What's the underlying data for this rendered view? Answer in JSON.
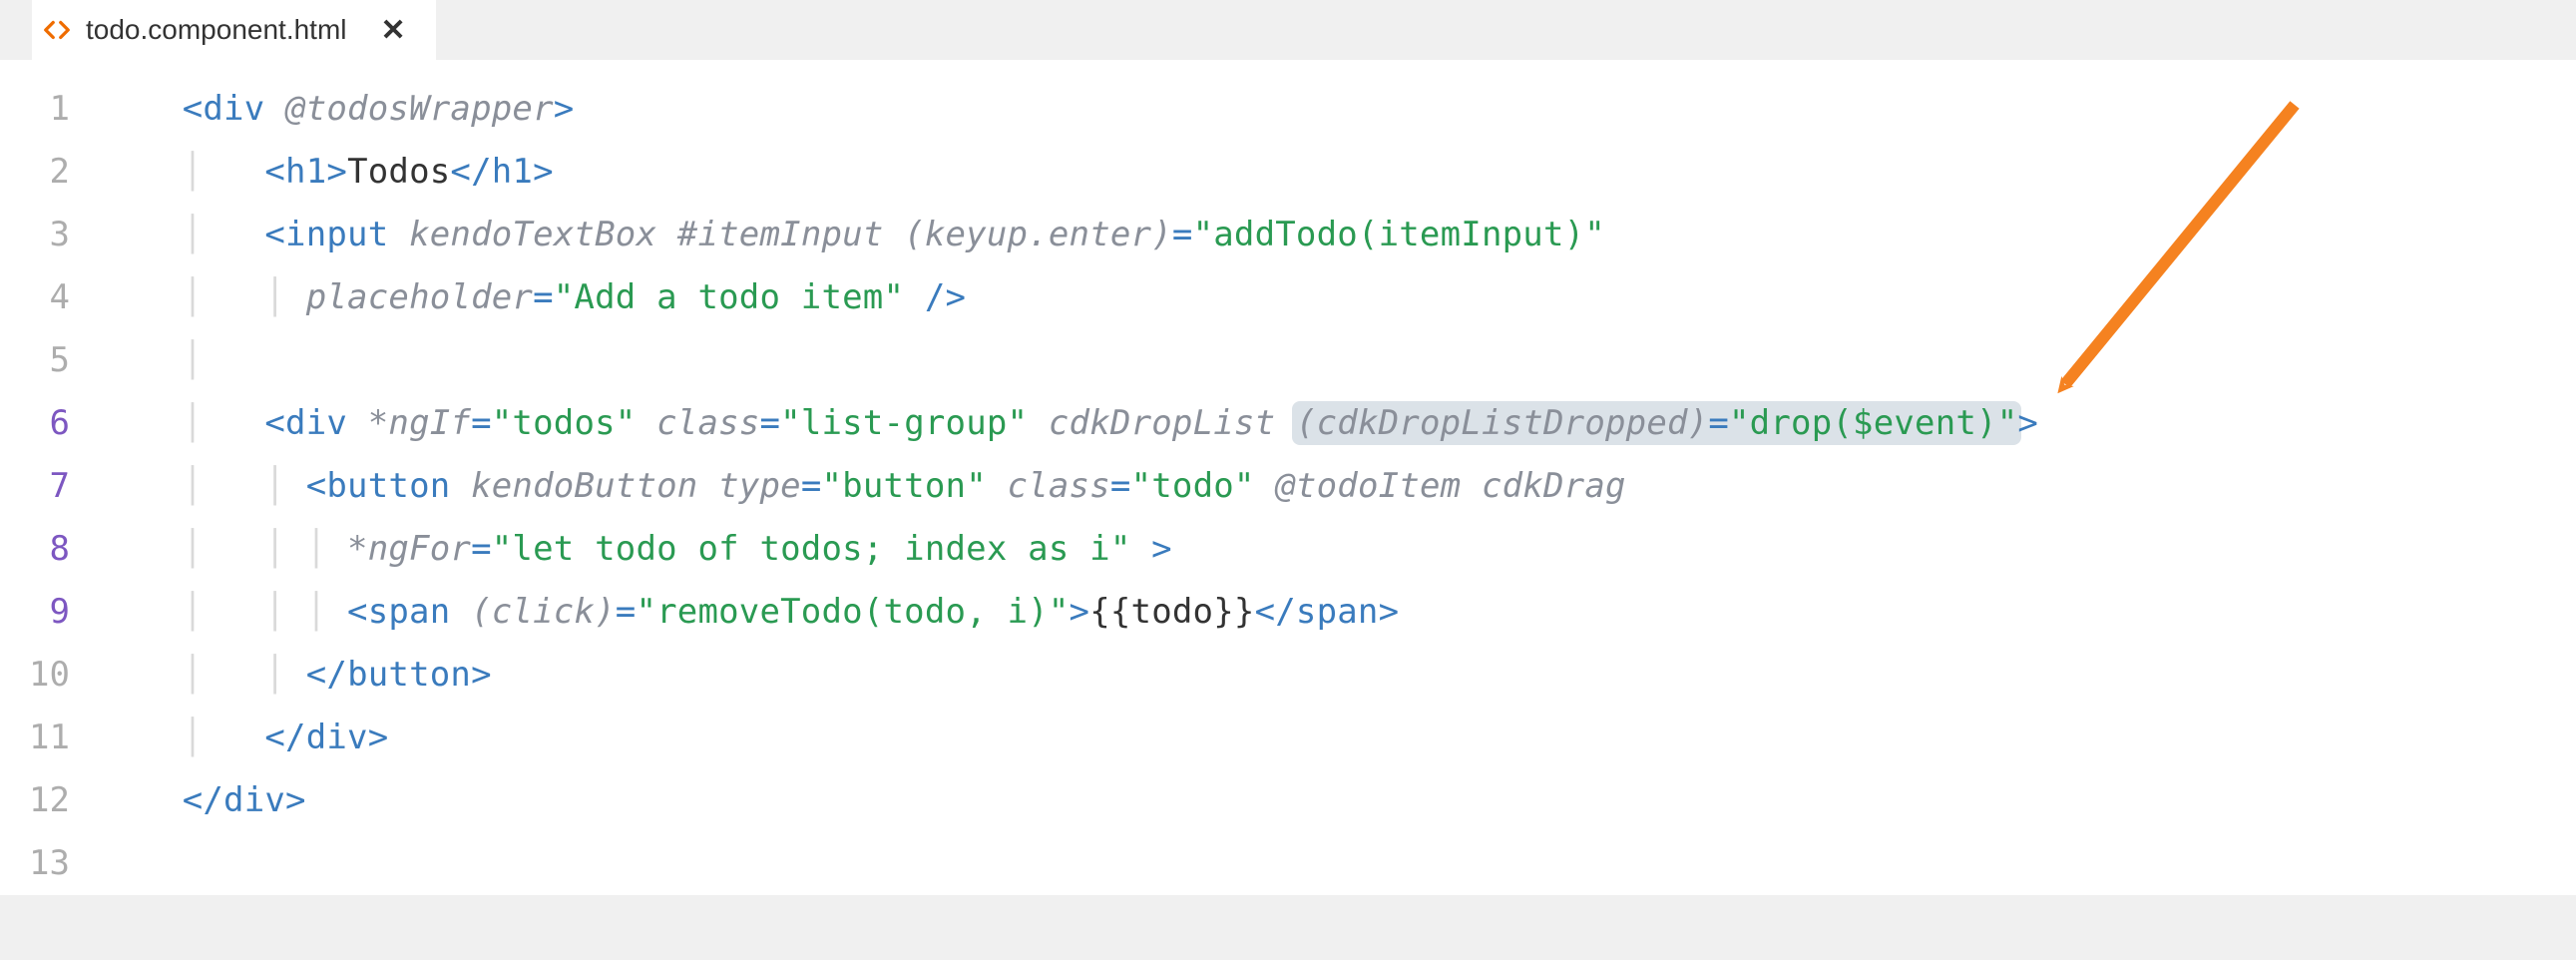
{
  "tab": {
    "filename": "todo.component.html"
  },
  "lines": {
    "n1": "1",
    "n2": "2",
    "n3": "3",
    "n4": "4",
    "n5": "5",
    "n6": "6",
    "n7": "7",
    "n8": "8",
    "n9": "9",
    "n10": "10",
    "n11": "11",
    "n12": "12",
    "n13": "13"
  },
  "code": {
    "l1": {
      "t1": "<",
      "t2": "div",
      "t3": " ",
      "t4": "@todosWrapper",
      "t5": ">"
    },
    "l2": {
      "t1": "<",
      "t2": "h1",
      "t3": ">",
      "t4": "Todos",
      "t5": "</",
      "t6": "h1",
      "t7": ">"
    },
    "l3": {
      "t1": "<",
      "t2": "input",
      "t3": " ",
      "t4": "kendoTextBox",
      "t5": " ",
      "t6": "#itemInput",
      "t7": " ",
      "t8": "(keyup.enter)",
      "t9": "=",
      "t10": "\"addTodo(itemInput)\""
    },
    "l4": {
      "t1": "placeholder",
      "t2": "=",
      "t3": "\"Add a todo item\"",
      "t4": " />"
    },
    "l6": {
      "t1": "<",
      "t2": "div",
      "t3": " ",
      "t4": "*ngIf",
      "t5": "=",
      "t6": "\"todos\"",
      "t7": " ",
      "t8": "class",
      "t9": "=",
      "t10": "\"list-group\"",
      "t11": " ",
      "t12": "cdkDropList",
      "t13": " ",
      "t14": "(cdkDropListDropped)",
      "t15": "=",
      "t16": "\"drop($event)\"",
      "t17": ">"
    },
    "l7": {
      "t1": "<",
      "t2": "button",
      "t3": " ",
      "t4": "kendoButton",
      "t5": " ",
      "t6": "type",
      "t7": "=",
      "t8": "\"button\"",
      "t9": " ",
      "t10": "class",
      "t11": "=",
      "t12": "\"todo\"",
      "t13": " ",
      "t14": "@todoItem",
      "t15": " ",
      "t16": "cdkDrag"
    },
    "l8": {
      "t1": "*ngFor",
      "t2": "=",
      "t3": "\"let todo of todos; index as i\"",
      "t4": " >"
    },
    "l9": {
      "t1": "<",
      "t2": "span",
      "t3": " ",
      "t4": "(click)",
      "t5": "=",
      "t6": "\"removeTodo(todo, i)\"",
      "t7": ">",
      "t8": "{{todo}}",
      "t9": "</",
      "t10": "span",
      "t11": ">"
    },
    "l10": {
      "t1": "</",
      "t2": "button",
      "t3": ">"
    },
    "l11": {
      "t1": "</",
      "t2": "div",
      "t3": ">"
    },
    "l12": {
      "t1": "</",
      "t2": "div",
      "t3": ">"
    }
  }
}
